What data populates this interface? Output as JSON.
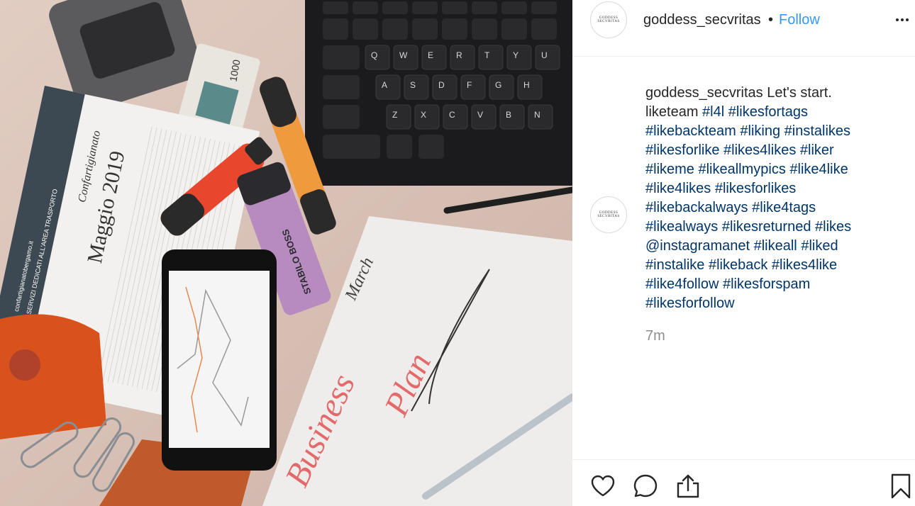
{
  "post": {
    "username": "goddess_secvritas",
    "separator": "•",
    "follow_label": "Follow",
    "avatar_text": "GODDESS SECVRITAS",
    "timestamp": "7m",
    "caption": {
      "username": "goddess_secvritas",
      "lines": [
        [
          {
            "t": "Let's start.",
            "tag": false
          }
        ],
        [
          {
            "t": "liketeam ",
            "tag": false
          },
          {
            "t": "#l4l",
            "tag": true
          },
          {
            "t": " ",
            "tag": false
          },
          {
            "t": "#likesfortags",
            "tag": true
          }
        ],
        [
          {
            "t": "#likebackteam",
            "tag": true
          },
          {
            "t": " ",
            "tag": false
          },
          {
            "t": "#liking",
            "tag": true
          },
          {
            "t": " ",
            "tag": false
          },
          {
            "t": "#instalikes",
            "tag": true
          }
        ],
        [
          {
            "t": "#likesforlike",
            "tag": true
          },
          {
            "t": " ",
            "tag": false
          },
          {
            "t": "#likes4likes",
            "tag": true
          },
          {
            "t": " ",
            "tag": false
          },
          {
            "t": "#liker",
            "tag": true
          }
        ],
        [
          {
            "t": "#likeme",
            "tag": true
          },
          {
            "t": " ",
            "tag": false
          },
          {
            "t": "#likeallmypics",
            "tag": true
          },
          {
            "t": " ",
            "tag": false
          },
          {
            "t": "#like4like",
            "tag": true
          }
        ],
        [
          {
            "t": "#like4likes",
            "tag": true
          },
          {
            "t": " ",
            "tag": false
          },
          {
            "t": "#likesforlikes",
            "tag": true
          }
        ],
        [
          {
            "t": "#likebackalways",
            "tag": true
          },
          {
            "t": " ",
            "tag": false
          },
          {
            "t": "#like4tags",
            "tag": true
          }
        ],
        [
          {
            "t": "#likealways",
            "tag": true
          },
          {
            "t": " ",
            "tag": false
          },
          {
            "t": "#likesreturned",
            "tag": true
          },
          {
            "t": " ",
            "tag": false
          },
          {
            "t": "#likes",
            "tag": true
          }
        ],
        [
          {
            "t": "@instagramanet",
            "tag": true
          },
          {
            "t": " ",
            "tag": false
          },
          {
            "t": "#likeall",
            "tag": true
          },
          {
            "t": " ",
            "tag": false
          },
          {
            "t": "#liked",
            "tag": true
          }
        ],
        [
          {
            "t": "#instalike",
            "tag": true
          },
          {
            "t": " ",
            "tag": false
          },
          {
            "t": "#likeback",
            "tag": true
          },
          {
            "t": " ",
            "tag": false
          },
          {
            "t": "#likes4like",
            "tag": true
          }
        ],
        [
          {
            "t": "#like4follow",
            "tag": true
          },
          {
            "t": " ",
            "tag": false
          },
          {
            "t": "#likesforspam",
            "tag": true
          }
        ],
        [
          {
            "t": "#likesforfollow",
            "tag": true
          }
        ]
      ]
    }
  },
  "photo": {
    "calendar_title": "Maggio 2019",
    "calendar_brand": "Confartigianato",
    "calendar_side_text": "SERVIZI DEDICATI ALL'AREA TRASPORTO",
    "calendar_url": "confartigianatobergamo.it",
    "stamp_text": "1000",
    "highlighter_text": "STABILO BOSS",
    "notebook_month": "March",
    "notebook_text_1": "Business",
    "notebook_text_2": "Plan",
    "keyboard_keys": [
      "Q",
      "W",
      "E",
      "R",
      "T",
      "Y",
      "U",
      "A",
      "S",
      "D",
      "F",
      "G",
      "H",
      "Z",
      "X",
      "C",
      "V",
      "B",
      "N"
    ]
  },
  "actions": {
    "like_icon": "heart-icon",
    "comment_icon": "comment-bubble-icon",
    "share_icon": "share-upload-icon",
    "save_icon": "bookmark-icon"
  },
  "colors": {
    "follow": "#3897f0",
    "hashtag": "#003569",
    "timestamp": "#8e8e8e",
    "text": "#262626"
  }
}
